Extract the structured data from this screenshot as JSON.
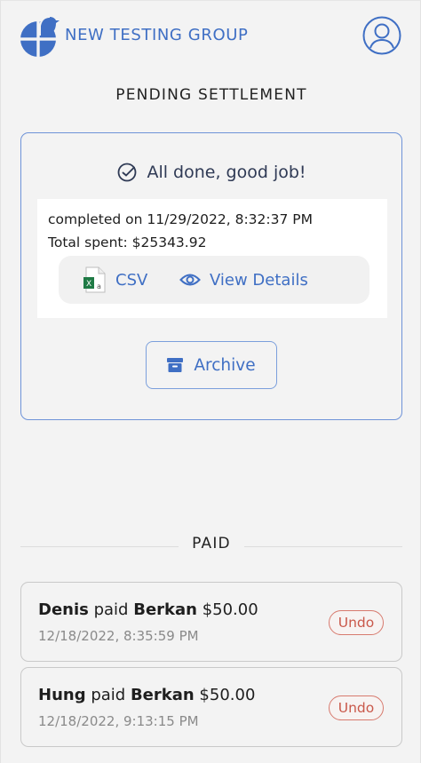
{
  "header": {
    "group_name": "NEW TESTING GROUP",
    "logo_icon": "pie-bird-logo-icon",
    "avatar_icon": "user-avatar-icon",
    "accent_color": "#3f6fc4"
  },
  "pending": {
    "title": "PENDING SETTLEMENT",
    "done_message": "All done, good job!",
    "completed_text": "completed on 11/29/2022, 8:32:37 PM",
    "total_text": "Total spent: $25343.92",
    "csv_label": "CSV",
    "view_details_label": "View Details",
    "archive_label": "Archive"
  },
  "paid": {
    "title": "PAID",
    "items": [
      {
        "payer": "Denis",
        "verb": "paid",
        "payee": "Berkan",
        "amount": "$50.00",
        "time": "12/18/2022, 8:35:59 PM",
        "undo_label": "Undo"
      },
      {
        "payer": "Hung",
        "verb": "paid",
        "payee": "Berkan",
        "amount": "$50.00",
        "time": "12/18/2022, 9:13:15 PM",
        "undo_label": "Undo"
      }
    ]
  },
  "colors": {
    "accent": "#3f6fc4",
    "card_border": "#6e93d8",
    "undo": "#c9584a"
  }
}
